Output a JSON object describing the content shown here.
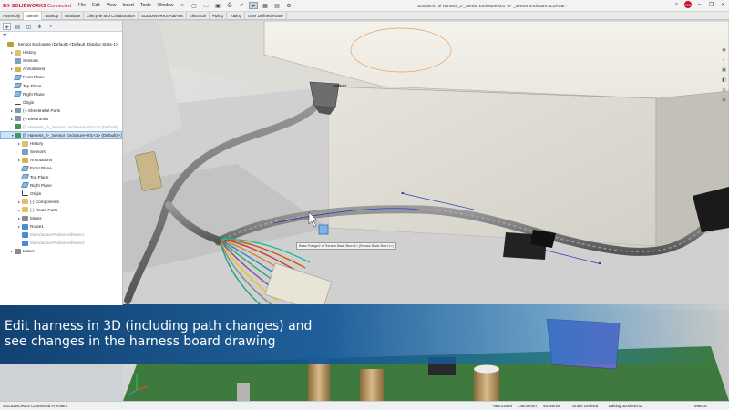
{
  "app": {
    "logo_ds": "DS",
    "logo_brand": "SOLIDWORKS",
    "logo_suffix": "Connected",
    "document_title": "3DSketch1 of Harness_2-_Sensor Enclosure-001 -in- _Sensor Enclosure.SLDASM *"
  },
  "menu": [
    "File",
    "Edit",
    "View",
    "Insert",
    "Tools",
    "Window"
  ],
  "quick_access": [
    {
      "icon": "home-icon",
      "glyph": "⌂"
    },
    {
      "icon": "new-document-icon",
      "glyph": "▢"
    },
    {
      "icon": "open-folder-icon",
      "glyph": "▭"
    },
    {
      "icon": "save-icon",
      "glyph": "▣"
    },
    {
      "icon": "print-icon",
      "glyph": "⎙"
    },
    {
      "icon": "undo-icon",
      "glyph": "↶"
    },
    {
      "icon": "select-arrow-icon",
      "glyph": "➤"
    },
    {
      "icon": "rebuild-icon",
      "glyph": "▦"
    },
    {
      "icon": "file-properties-icon",
      "glyph": "▤"
    },
    {
      "icon": "options-gear-icon",
      "glyph": "⚙"
    }
  ],
  "window_controls": {
    "avatar": "RS",
    "search": "⌕",
    "minimize": "–",
    "restore": "❐",
    "close": "✕"
  },
  "command_tabs": [
    "Assembly",
    "Sketch",
    "Markup",
    "Evaluate",
    "Lifecycle and Collaboration",
    "SOLIDWORKS Add-Ins",
    "Electrical",
    "Piping",
    "Tubing",
    "User Defined Route"
  ],
  "tree": [
    {
      "label": "_Sensor Enclosure (Default) <Default_Display State-1>",
      "icon": "ic-assy",
      "indent": 0,
      "arrow": "",
      "dim": false,
      "selected": false
    },
    {
      "label": "History",
      "icon": "ic-folder",
      "indent": 1,
      "arrow": "▸",
      "dim": false,
      "selected": false
    },
    {
      "label": "Sensors",
      "icon": "ic-sensor",
      "indent": 1,
      "arrow": "",
      "dim": false,
      "selected": false
    },
    {
      "label": "Annotations",
      "icon": "ic-anno",
      "indent": 1,
      "arrow": "▸",
      "dim": false,
      "selected": false
    },
    {
      "label": "Front Plane",
      "icon": "ic-plane",
      "indent": 1,
      "arrow": "",
      "dim": false,
      "selected": false
    },
    {
      "label": "Top Plane",
      "icon": "ic-plane",
      "indent": 1,
      "arrow": "",
      "dim": false,
      "selected": false
    },
    {
      "label": "Right Plane",
      "icon": "ic-plane",
      "indent": 1,
      "arrow": "",
      "dim": false,
      "selected": false
    },
    {
      "label": "Origin",
      "icon": "ic-origin",
      "indent": 1,
      "arrow": "",
      "dim": false,
      "selected": false
    },
    {
      "label": "(-) Sheetmetal Parts",
      "icon": "ic-part",
      "indent": 1,
      "arrow": "▸",
      "dim": false,
      "selected": false
    },
    {
      "label": "(-) Electronics",
      "icon": "ic-part",
      "indent": 1,
      "arrow": "▸",
      "dim": false,
      "selected": false
    },
    {
      "label": "(f) Harness_2-_Sensor Enclosure-001<1> (Default)",
      "icon": "ic-harness",
      "indent": 1,
      "arrow": "",
      "dim": true,
      "selected": false
    },
    {
      "label": "(f) Harness_2-_Sensor Enclosure-001<1> (Default) <",
      "icon": "ic-harness",
      "indent": 1,
      "arrow": "▾",
      "dim": false,
      "selected": true
    },
    {
      "label": "History",
      "icon": "ic-folder",
      "indent": 2,
      "arrow": "▸",
      "dim": false,
      "selected": false
    },
    {
      "label": "Sensors",
      "icon": "ic-sensor",
      "indent": 2,
      "arrow": "",
      "dim": false,
      "selected": false
    },
    {
      "label": "Annotations",
      "icon": "ic-anno",
      "indent": 2,
      "arrow": "▸",
      "dim": false,
      "selected": false
    },
    {
      "label": "Front Plane",
      "icon": "ic-plane",
      "indent": 2,
      "arrow": "",
      "dim": false,
      "selected": false
    },
    {
      "label": "Top Plane",
      "icon": "ic-plane",
      "indent": 2,
      "arrow": "",
      "dim": false,
      "selected": false
    },
    {
      "label": "Right Plane",
      "icon": "ic-plane",
      "indent": 2,
      "arrow": "",
      "dim": false,
      "selected": false
    },
    {
      "label": "Origin",
      "icon": "ic-origin",
      "indent": 2,
      "arrow": "",
      "dim": false,
      "selected": false
    },
    {
      "label": "(-) Components",
      "icon": "ic-folder",
      "indent": 2,
      "arrow": "▸",
      "dim": false,
      "selected": false
    },
    {
      "label": "(-) Route Parts",
      "icon": "ic-folder",
      "indent": 2,
      "arrow": "▸",
      "dim": false,
      "selected": false
    },
    {
      "label": "Mates",
      "icon": "ic-mate",
      "indent": 2,
      "arrow": "▸",
      "dim": false,
      "selected": false
    },
    {
      "label": "Route1",
      "icon": "ic-route",
      "indent": 2,
      "arrow": "▸",
      "dim": false,
      "selected": false
    },
    {
      "label": "ManufactureFlattenedRoute1",
      "icon": "ic-route",
      "indent": 2,
      "arrow": "",
      "dim": true,
      "selected": false
    },
    {
      "label": "ManufactureFlattenedRoute2",
      "icon": "ic-route",
      "indent": 2,
      "arrow": "",
      "dim": true,
      "selected": false
    },
    {
      "label": "Mates",
      "icon": "ic-mate",
      "indent": 1,
      "arrow": "▸",
      "dim": false,
      "selected": false
    }
  ],
  "viewport": {
    "connector_label": "CPIN#1",
    "tooltip": "Base-Flange2 of Sensor Back Box<1> (Sensor Back Box<1>)",
    "banner_line1": "Edit harness in 3D (including path changes) and",
    "banner_line2": "see changes in the harness board drawing"
  },
  "status": {
    "product": "SOLIDWORKS Connected Premium",
    "x": "-483.42mm",
    "y": "146.09mm",
    "z": "46.94mm",
    "state": "Under Defined",
    "editing": "Editing 3DSketch1",
    "units": "MMGS"
  },
  "colors": {
    "brand": "#c8102e",
    "banner": "#0f5a9c",
    "selection": "#cfe2f6",
    "route_line": "#2a3fb0"
  }
}
